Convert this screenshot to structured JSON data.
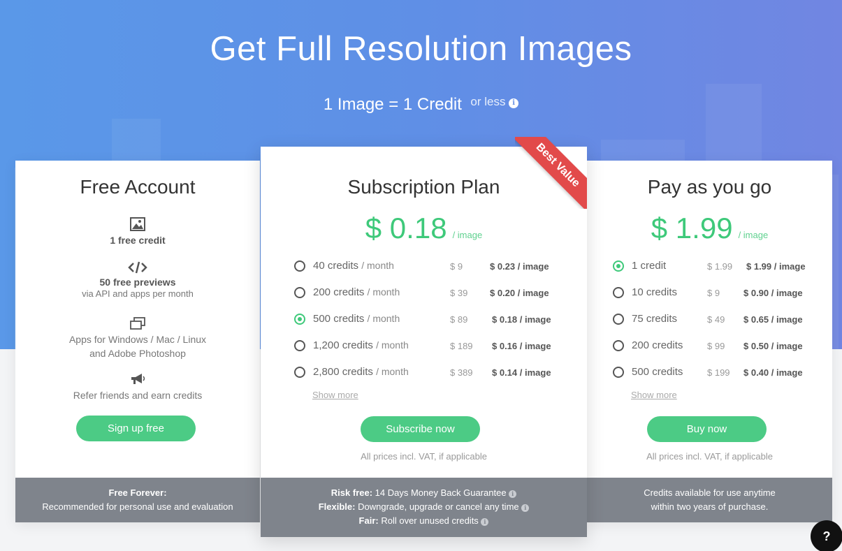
{
  "header": {
    "title": "Get Full Resolution Images",
    "subtitle": "1 Image = 1 Credit",
    "subtitle_suffix": "or less"
  },
  "free": {
    "title": "Free Account",
    "features": [
      {
        "icon": "image-icon",
        "bold": "1 free credit",
        "text": ""
      },
      {
        "icon": "code-icon",
        "bold": "50 free previews",
        "text": "via API and apps per month"
      },
      {
        "icon": "windows-icon",
        "bold": "",
        "text": "Apps for Windows / Mac / Linux and Adobe Photoshop"
      },
      {
        "icon": "megaphone-icon",
        "bold": "",
        "text": "Refer friends and earn credits"
      }
    ],
    "feature_text_1": "via API and apps per month",
    "feature_text_2a": "Apps for Windows / Mac / Linux",
    "feature_text_2b": "and Adobe Photoshop",
    "feature_text_3": "Refer friends and earn credits",
    "button": "Sign up free",
    "footer_bold": "Free Forever:",
    "footer_text": "Recommended for personal use and evaluation"
  },
  "subscription": {
    "title": "Subscription Plan",
    "ribbon": "Best Value",
    "price": "$ 0.18",
    "price_unit": "/ image",
    "options": [
      {
        "credits": "40 credits",
        "per": "/ month",
        "price": "$ 9",
        "each": "$ 0.23 / image",
        "selected": false
      },
      {
        "credits": "200 credits",
        "per": "/ month",
        "price": "$ 39",
        "each": "$ 0.20 / image",
        "selected": false
      },
      {
        "credits": "500 credits",
        "per": "/ month",
        "price": "$ 89",
        "each": "$ 0.18 / image",
        "selected": true
      },
      {
        "credits": "1,200 credits",
        "per": "/ month",
        "price": "$ 189",
        "each": "$ 0.16 / image",
        "selected": false
      },
      {
        "credits": "2,800 credits",
        "per": "/ month",
        "price": "$ 389",
        "each": "$ 0.14 / image",
        "selected": false
      }
    ],
    "show_more": "Show more",
    "button": "Subscribe now",
    "note": "All prices incl. VAT, if applicable",
    "footer": [
      {
        "bold": "Risk free:",
        "text": "14 Days Money Back Guarantee"
      },
      {
        "bold": "Flexible:",
        "text": "Downgrade, upgrade or cancel any time"
      },
      {
        "bold": "Fair:",
        "text": "Roll over unused credits"
      }
    ]
  },
  "payg": {
    "title": "Pay as you go",
    "price": "$ 1.99",
    "price_unit": "/ image",
    "options": [
      {
        "credits": "1 credit",
        "price": "$ 1.99",
        "each": "$ 1.99 / image",
        "selected": true
      },
      {
        "credits": "10 credits",
        "price": "$ 9",
        "each": "$ 0.90 / image",
        "selected": false
      },
      {
        "credits": "75 credits",
        "price": "$ 49",
        "each": "$ 0.65 / image",
        "selected": false
      },
      {
        "credits": "200 credits",
        "price": "$ 99",
        "each": "$ 0.50 / image",
        "selected": false
      },
      {
        "credits": "500 credits",
        "price": "$ 199",
        "each": "$ 0.40 / image",
        "selected": false
      }
    ],
    "show_more": "Show more",
    "button": "Buy now",
    "note": "All prices incl. VAT, if applicable",
    "footer_line1": "Credits available for use anytime",
    "footer_line2": "within two years of purchase."
  },
  "help_label": "?",
  "colors": {
    "accent": "#4ccb85",
    "ribbon": "#e24a4a",
    "hero": "#5f8fe6",
    "footer": "#7f848c"
  }
}
